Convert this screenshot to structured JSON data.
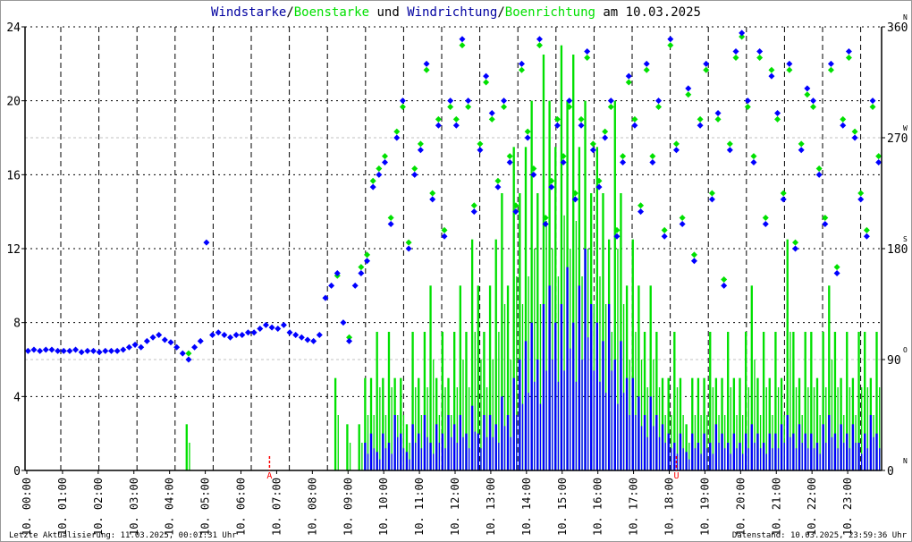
{
  "chart_data": {
    "type": "bar+scatter",
    "title_parts": [
      {
        "text": "Windstarke",
        "color": "#0000a0"
      },
      {
        "text": "/",
        "color": "#000000"
      },
      {
        "text": "Boenstarke",
        "color": "#00e000"
      },
      {
        "text": " und ",
        "color": "#000000"
      },
      {
        "text": "Windrichtung",
        "color": "#0000a0"
      },
      {
        "text": "/",
        "color": "#000000"
      },
      {
        "text": "Boenrichtung",
        "color": "#00e000"
      },
      {
        "text": " am 10.03.2025",
        "color": "#000000"
      }
    ],
    "ylim_left": [
      0,
      24
    ],
    "yticks_left": [
      "0",
      "4",
      "8",
      "12",
      "16",
      "20",
      "24"
    ],
    "ylim_right": [
      0,
      360
    ],
    "yticks_right": [
      {
        "value": 0,
        "label": "0",
        "compass": "N"
      },
      {
        "value": 90,
        "label": "90",
        "compass": "O"
      },
      {
        "value": 180,
        "label": "180",
        "compass": "S"
      },
      {
        "value": 270,
        "label": "270",
        "compass": "W"
      },
      {
        "value": 360,
        "label": "360",
        "compass": "N"
      }
    ],
    "xlim_hours": [
      0,
      24
    ],
    "xtick_labels": [
      "10. 00:00",
      "10. 01:00",
      "10. 02:00",
      "10. 03:00",
      "10. 04:00",
      "10. 05:00",
      "10. 06:00",
      "10. 07:00",
      "10. 08:00",
      "10. 09:00",
      "10. 10:00",
      "10. 11:00",
      "10. 12:00",
      "10. 13:00",
      "10. 14:00",
      "10. 15:00",
      "10. 16:00",
      "10. 17:00",
      "10. 18:00",
      "10. 19:00",
      "10. 20:00",
      "10. 21:00",
      "10. 22:00",
      "10. 23:00"
    ],
    "markers": [
      {
        "label": "A",
        "hour": 6.85,
        "color": "#ff0000"
      },
      {
        "label": "U",
        "hour": 18.25,
        "color": "#ff0000"
      }
    ],
    "interval_minutes": 10,
    "colors": {
      "wind": "#0000ff",
      "gust": "#00e000",
      "grid": "#000000",
      "grid_light": "#c0c0c0",
      "marker": "#ff0000"
    },
    "series": [
      {
        "name": "Windstarke",
        "axis": "left",
        "kind": "bar",
        "values": [
          0,
          0,
          0,
          0,
          0,
          0,
          0,
          0,
          0,
          0,
          0,
          0,
          0,
          0,
          0,
          0,
          0,
          0,
          0,
          0,
          0,
          0,
          0,
          0,
          0,
          0,
          0,
          0,
          0,
          0,
          0,
          0,
          0,
          0,
          0,
          0,
          0,
          0,
          0,
          0,
          0,
          0,
          0,
          0,
          0,
          0,
          0,
          0,
          0,
          0,
          0,
          0,
          0,
          0,
          0,
          0,
          0,
          1.5,
          2,
          1,
          2,
          1.5,
          3,
          2,
          1,
          2.5,
          2,
          3,
          1.5,
          2.5,
          2,
          3,
          2.5,
          3,
          2,
          3.5,
          2,
          3,
          3,
          2.5,
          4,
          3,
          5,
          6,
          7,
          8,
          6,
          9,
          10,
          8,
          9,
          11,
          8,
          10,
          12,
          9,
          8,
          7,
          9,
          6,
          7,
          5,
          5,
          4,
          3,
          4,
          3,
          2.5,
          2,
          1.5,
          2,
          1,
          2,
          1.5,
          2,
          1.5,
          2.5,
          2,
          1.5,
          2,
          1.5,
          2,
          2.5,
          2,
          1.5,
          2,
          2,
          2.5,
          3,
          2,
          2.5,
          2,
          2,
          1.5,
          2.5,
          3,
          2,
          2.5,
          2,
          2.5,
          1.5,
          2,
          3,
          2
        ]
      },
      {
        "name": "Boenstarke",
        "axis": "left",
        "kind": "bar",
        "values": [
          0,
          0,
          0,
          0,
          0,
          0,
          0,
          0,
          0,
          0,
          0,
          0,
          0,
          0,
          0,
          0,
          0,
          0,
          0,
          0,
          0,
          0,
          0,
          0,
          0,
          0,
          0,
          2.5,
          0,
          0,
          0,
          0,
          0,
          0,
          0,
          0,
          0,
          0,
          0,
          0,
          0,
          0,
          0,
          0,
          0,
          0,
          0,
          0,
          0,
          0,
          0,
          0,
          5,
          0,
          2.5,
          0,
          2.5,
          5,
          5,
          7.5,
          5,
          7.5,
          5,
          5,
          2.5,
          7.5,
          5,
          7.5,
          10,
          5,
          7.5,
          5,
          7.5,
          10,
          7.5,
          12.5,
          10,
          7.5,
          10,
          12.5,
          15,
          10,
          17.5,
          15,
          17.5,
          20,
          15,
          22.5,
          20,
          17.5,
          23,
          20,
          22.5,
          17.5,
          20,
          15,
          17.5,
          15,
          12.5,
          20,
          15,
          10,
          12.5,
          10,
          7.5,
          10,
          7.5,
          5,
          5,
          7.5,
          5,
          2.5,
          5,
          5,
          5,
          7.5,
          5,
          5,
          7.5,
          5,
          5,
          7.5,
          10,
          5,
          7.5,
          5,
          7.5,
          5,
          12.5,
          7.5,
          5,
          7.5,
          7.5,
          5,
          7.5,
          10,
          7.5,
          5,
          7.5,
          5,
          7.5,
          7.5,
          5,
          7.5
        ]
      },
      {
        "name": "Windrichtung",
        "axis": "right",
        "kind": "scatter",
        "values": [
          97,
          98,
          97,
          98,
          98,
          97,
          97,
          97,
          98,
          96,
          97,
          97,
          96,
          97,
          97,
          97,
          98,
          100,
          102,
          100,
          105,
          108,
          110,
          106,
          104,
          100,
          95,
          90,
          100,
          105,
          185,
          110,
          112,
          110,
          108,
          110,
          110,
          112,
          112,
          115,
          118,
          116,
          115,
          118,
          112,
          110,
          108,
          106,
          105,
          110,
          140,
          150,
          160,
          120,
          105,
          150,
          160,
          170,
          230,
          240,
          250,
          200,
          270,
          300,
          180,
          240,
          260,
          330,
          220,
          280,
          190,
          300,
          280,
          350,
          300,
          210,
          260,
          320,
          290,
          230,
          300,
          250,
          210,
          330,
          270,
          240,
          350,
          200,
          230,
          280,
          250,
          300,
          220,
          280,
          340,
          260,
          230,
          270,
          300,
          190,
          250,
          320,
          280,
          210,
          330,
          250,
          300,
          190,
          350,
          260,
          200,
          310,
          170,
          280,
          330,
          220,
          290,
          150,
          260,
          340,
          355,
          300,
          250,
          340,
          200,
          320,
          290,
          220,
          330,
          180,
          260,
          310,
          300,
          240,
          200,
          330,
          160,
          280,
          340,
          270,
          220,
          190,
          300,
          250
        ]
      },
      {
        "name": "Boenrichtung",
        "axis": "right",
        "kind": "scatter",
        "values": [
          null,
          null,
          null,
          null,
          null,
          null,
          null,
          null,
          null,
          null,
          null,
          null,
          null,
          null,
          null,
          null,
          null,
          null,
          null,
          null,
          null,
          null,
          null,
          null,
          null,
          null,
          null,
          95,
          null,
          null,
          null,
          null,
          null,
          null,
          null,
          null,
          null,
          null,
          null,
          null,
          null,
          null,
          null,
          null,
          null,
          null,
          null,
          null,
          null,
          null,
          null,
          null,
          158,
          null,
          108,
          null,
          165,
          175,
          235,
          245,
          255,
          205,
          275,
          295,
          185,
          245,
          265,
          325,
          225,
          285,
          195,
          295,
          285,
          345,
          295,
          215,
          265,
          315,
          285,
          235,
          295,
          255,
          215,
          325,
          275,
          245,
          345,
          205,
          235,
          285,
          255,
          295,
          225,
          285,
          335,
          265,
          235,
          275,
          295,
          195,
          255,
          315,
          285,
          215,
          325,
          255,
          295,
          195,
          345,
          265,
          205,
          305,
          175,
          285,
          325,
          225,
          285,
          155,
          265,
          335,
          352,
          295,
          255,
          335,
          205,
          325,
          285,
          225,
          325,
          185,
          265,
          305,
          295,
          245,
          205,
          325,
          165,
          285,
          335,
          275,
          225,
          195,
          295,
          255
        ]
      }
    ]
  },
  "footer": {
    "left": "Letzte Aktualisierung: 11.03.2025, 00:01:31 Uhr",
    "right": "Datenstand: 10.03.2025, 23:59:36 Uhr"
  }
}
